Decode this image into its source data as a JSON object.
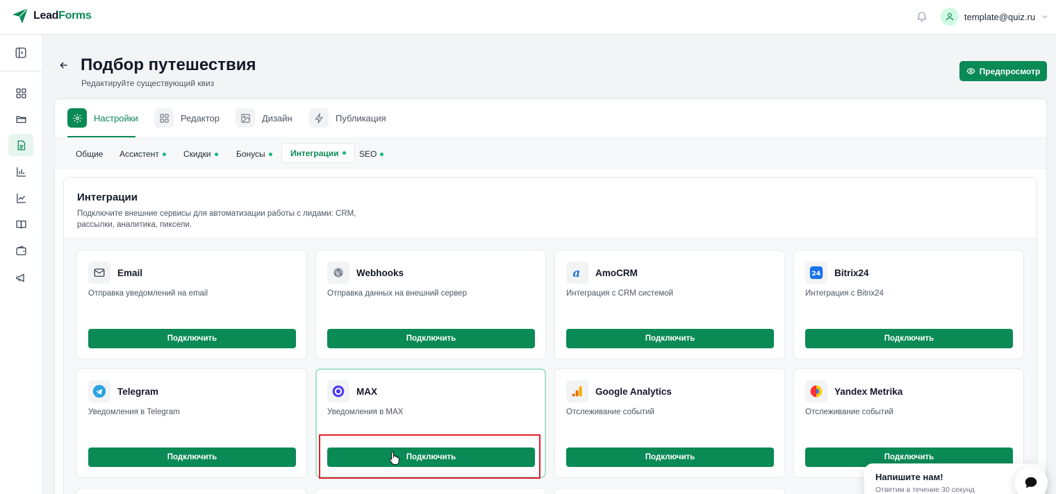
{
  "brand": {
    "logo_lead": "Lead",
    "logo_forms": "Forms",
    "accent": "#0a8a55"
  },
  "user": {
    "email": "template@quiz.ru"
  },
  "sidebar": {
    "items": [
      {
        "icon": "dashboard-icon"
      },
      {
        "icon": "folder-icon"
      },
      {
        "icon": "document-icon",
        "active": true
      },
      {
        "icon": "bar-chart-icon"
      },
      {
        "icon": "line-chart-icon"
      },
      {
        "icon": "book-icon"
      },
      {
        "icon": "wallet-icon"
      },
      {
        "icon": "megaphone-icon"
      }
    ]
  },
  "page": {
    "title": "Подбор путешествия",
    "subtitle": "Редактируйте существующий квиз",
    "preview_label": "Предпросмотр"
  },
  "tabs": [
    {
      "label": "Настройки",
      "active": true
    },
    {
      "label": "Редактор"
    },
    {
      "label": "Дизайн"
    },
    {
      "label": "Публикация"
    }
  ],
  "subtabs": [
    {
      "label": "Общие",
      "dot": false
    },
    {
      "label": "Ассистент",
      "dot": true
    },
    {
      "label": "Скидки",
      "dot": true
    },
    {
      "label": "Бонусы",
      "dot": true
    },
    {
      "label": "Интеграции",
      "dot": true,
      "active": true
    },
    {
      "label": "SEO",
      "dot": true
    }
  ],
  "integrations": {
    "title": "Интеграции",
    "description": "Подключите внешние сервисы для автоматизации работы с лидами: CRM, рассылки, аналитика, пиксели.",
    "cards": [
      {
        "title": "Email",
        "desc": "Отправка уведомлений на email",
        "button": "Подключить",
        "icon": "mail-icon"
      },
      {
        "title": "Webhooks",
        "desc": "Отправка данных на внешний сервер",
        "button": "Подключить",
        "icon": "webhook-icon"
      },
      {
        "title": "AmoCRM",
        "desc": "Интеграция с CRM системой",
        "button": "Подключить",
        "icon": "amocrm-icon"
      },
      {
        "title": "Bitrix24",
        "desc": "Интеграция с Bitrix24",
        "button": "Подключить",
        "icon": "bitrix24-icon"
      },
      {
        "title": "Telegram",
        "desc": "Уведомления в Telegram",
        "button": "Подключить",
        "icon": "telegram-icon"
      },
      {
        "title": "MAX",
        "desc": "Уведомления в MAX",
        "button": "Подключить",
        "icon": "max-icon"
      },
      {
        "title": "Google Analytics",
        "desc": "Отслеживание событий",
        "button": "Подключить",
        "icon": "google-analytics-icon"
      },
      {
        "title": "Yandex Metrika",
        "desc": "Отслеживание событий",
        "button": "Подключить",
        "icon": "yandex-metrika-icon"
      }
    ]
  },
  "chat": {
    "title": "Напишите нам!",
    "subtitle": "Ответим в течение 30 секунд"
  }
}
